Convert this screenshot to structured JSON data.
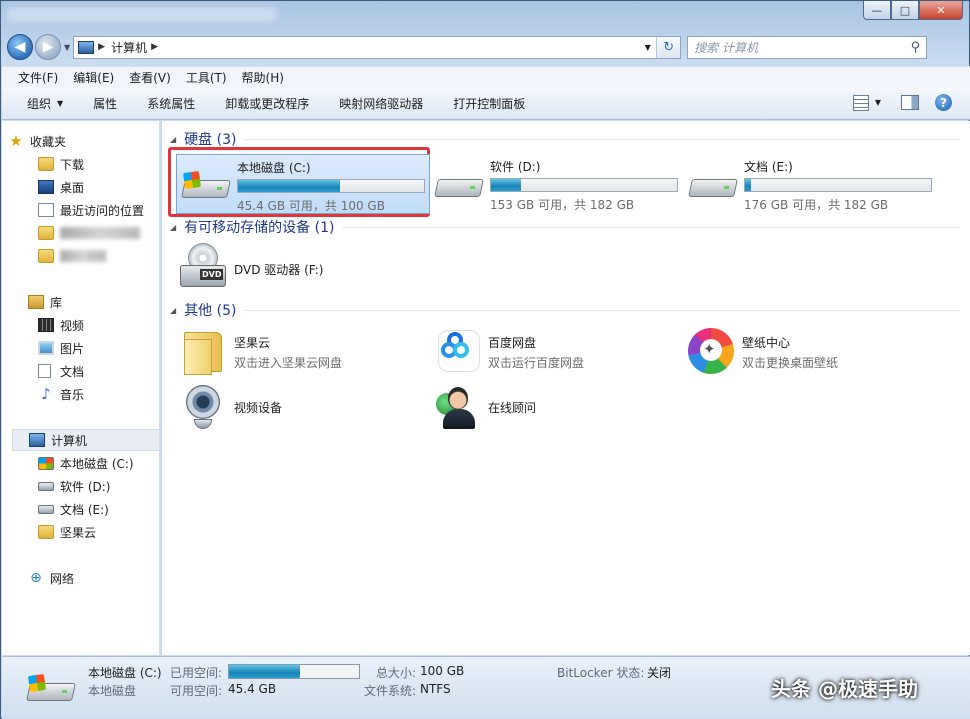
{
  "navigation": {
    "address_path": "计算机",
    "search_placeholder": "搜索 计算机"
  },
  "menubar": [
    "文件(F)",
    "编辑(E)",
    "查看(V)",
    "工具(T)",
    "帮助(H)"
  ],
  "toolbar": {
    "organize": "组织",
    "items": [
      "属性",
      "系统属性",
      "卸载或更改程序",
      "映射网络驱动器",
      "打开控制面板"
    ]
  },
  "sidebar": {
    "favorites": "收藏夹",
    "fav_items": [
      "下载",
      "桌面",
      "最近访问的位置"
    ],
    "libraries": "库",
    "lib_items": [
      "视频",
      "图片",
      "文档",
      "音乐"
    ],
    "computer": "计算机",
    "computer_items": [
      "本地磁盘 (C:)",
      "软件 (D:)",
      "文档 (E:)",
      "坚果云"
    ],
    "network": "网络"
  },
  "groups": {
    "hard_disks": "硬盘 (3)",
    "removable": "有可移动存储的设备 (1)",
    "other": "其他 (5)"
  },
  "drives": [
    {
      "name": "本地磁盘 (C:)",
      "size_text": "45.4 GB 可用，共 100 GB",
      "used_fraction": 0.546,
      "selected": true
    },
    {
      "name": "软件 (D:)",
      "size_text": "153 GB 可用，共 182 GB",
      "used_fraction": 0.16,
      "selected": false
    },
    {
      "name": "文档 (E:)",
      "size_text": "176 GB 可用，共 182 GB",
      "used_fraction": 0.03,
      "selected": false
    }
  ],
  "removable": [
    {
      "name": "DVD 驱动器 (F:)",
      "icon_text": "DVD"
    }
  ],
  "other_items": [
    {
      "name": "坚果云",
      "desc": "双击进入坚果云网盘"
    },
    {
      "name": "百度网盘",
      "desc": "双击运行百度网盘"
    },
    {
      "name": "壁纸中心",
      "desc": "双击更换桌面壁纸"
    },
    {
      "name": "视频设备",
      "desc": ""
    },
    {
      "name": "在线顾问",
      "desc": ""
    }
  ],
  "status": {
    "name": "本地磁盘 (C:)",
    "type": "本地磁盘",
    "used_label": "已用空间:",
    "free_label": "可用空间:",
    "free_value": "45.4 GB",
    "used_fraction": 0.546,
    "total_label": "总大小:",
    "total_value": "100 GB",
    "fs_label": "文件系统:",
    "fs_value": "NTFS",
    "bitlocker_label": "BitLocker 状态:",
    "bitlocker_value": "关闭"
  },
  "watermark": "头条 @极速手助"
}
